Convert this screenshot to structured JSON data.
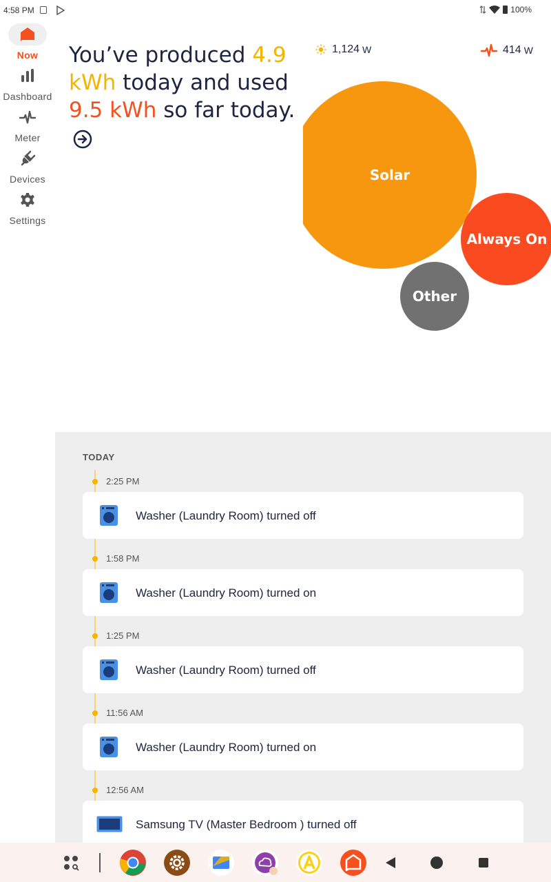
{
  "status_bar": {
    "time": "4:58 PM",
    "battery": "100%"
  },
  "nav": {
    "items": [
      {
        "label": "Now",
        "icon": "home-bubble-icon",
        "active": true
      },
      {
        "label": "Dashboard",
        "icon": "bar-chart-icon",
        "active": false
      },
      {
        "label": "Meter",
        "icon": "pulse-icon",
        "active": false
      },
      {
        "label": "Devices",
        "icon": "plug-icon",
        "active": false
      },
      {
        "label": "Settings",
        "icon": "gear-icon",
        "active": false
      }
    ]
  },
  "headline": {
    "part1": "You’ve produced ",
    "produced": "4.9 kWh",
    "part2": " today and used ",
    "used": "9.5 kWh",
    "part3": " so far today."
  },
  "readings": {
    "solar": {
      "value": "1,124",
      "unit": "W",
      "icon": "sun-icon"
    },
    "usage": {
      "value": "414",
      "unit": "W",
      "icon": "pulse-icon"
    }
  },
  "bubbles": [
    {
      "label": "Solar",
      "color": "#f7960f"
    },
    {
      "label": "Always On",
      "color": "#fa4a20"
    },
    {
      "label": "Other",
      "color": "#717171"
    }
  ],
  "timeline": {
    "heading": "TODAY",
    "events": [
      {
        "time": "2:25 PM",
        "text": "Washer (Laundry Room) turned off",
        "icon": "washer-icon"
      },
      {
        "time": "1:58 PM",
        "text": "Washer (Laundry Room) turned on",
        "icon": "washer-icon"
      },
      {
        "time": "1:25 PM",
        "text": "Washer (Laundry Room) turned off",
        "icon": "washer-icon"
      },
      {
        "time": "11:56 AM",
        "text": "Washer (Laundry Room) turned on",
        "icon": "washer-icon"
      },
      {
        "time": "12:56 AM",
        "text": "Samsung TV (Master Bedroom ) turned off",
        "icon": "tv-icon"
      }
    ]
  },
  "colors": {
    "accent_red": "#f4511e",
    "accent_yellow": "#f4b400",
    "text_dark": "#1c2541",
    "washer_blue": "#4a90e2"
  },
  "taskbar": {
    "apps": [
      "app-drawer-icon",
      "chrome-icon",
      "settings-app-icon",
      "files-app-icon",
      "cloud-app-icon",
      "arlo-app-icon",
      "sense-app-icon"
    ],
    "nav": [
      "back-icon",
      "home-icon",
      "recents-icon"
    ]
  }
}
